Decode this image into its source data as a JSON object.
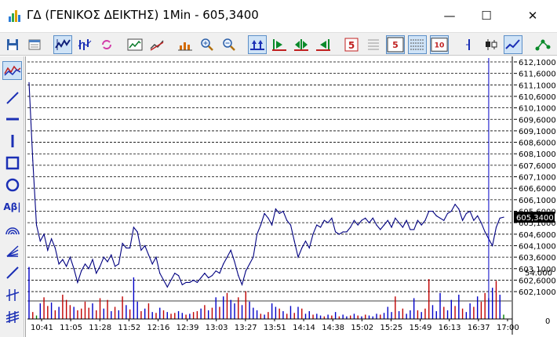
{
  "window": {
    "title": "ΓΔ (ΓΕΝΙΚΟΣ ΔΕΙΚΤΗΣ) 1Min - 605,3400",
    "minimize_glyph": "—",
    "maximize_glyph": "☐",
    "close_glyph": "✕"
  },
  "toolbar": {
    "period_labels": [
      "5",
      "5",
      "10"
    ]
  },
  "sidebar": {
    "text_tool_label": "Aβ|"
  },
  "colors": {
    "price_line": "#000080",
    "volume_up": "#0000c8",
    "volume_down": "#c00000",
    "volume_neutral": "#008000",
    "grid": "#000000",
    "current_price_bg": "#000000",
    "current_price_fg": "#ffffff",
    "cursor_line": "#0000c8"
  },
  "chart_data": {
    "type": "line",
    "price_axis": {
      "ylim": [
        601.83,
        612.27
      ],
      "tick_values": [
        612.1,
        611.6,
        611.1,
        610.6,
        610.1,
        609.6,
        609.1,
        608.6,
        608.1,
        607.6,
        607.1,
        606.6,
        606.1,
        605.6,
        605.1,
        604.6,
        604.1,
        603.6,
        603.1,
        602.6,
        602.1
      ],
      "tick_labels": [
        "612,1000",
        "611,6000",
        "611,1000",
        "610,6000",
        "610,1000",
        "609,6000",
        "609,1000",
        "608,6000",
        "608,1000",
        "607,6000",
        "607,1000",
        "606,6000",
        "606,1000",
        "605,6000",
        "605,1000",
        "604,6000",
        "604,1000",
        "603,6000",
        "603,1000",
        "602,6000",
        "602,1000"
      ],
      "current_value": 605.34,
      "current_label": "605,3400",
      "grid": true
    },
    "volume_axis": {
      "tick_labels": [
        "54.000",
        "0"
      ],
      "tick_values": [
        54000,
        0
      ],
      "ylim": [
        0,
        66000
      ]
    },
    "x_tick_labels": [
      "10:41",
      "11:05",
      "11:28",
      "11:52",
      "12:16",
      "12:39",
      "13:03",
      "13:27",
      "13:51",
      "14:14",
      "14:38",
      "15:02",
      "15:25",
      "15:49",
      "16:13",
      "16:37",
      "17:00"
    ],
    "price_series": [
      [
        0,
        611.2
      ],
      [
        1,
        607.8
      ],
      [
        2,
        605.0
      ],
      [
        3,
        604.3
      ],
      [
        4,
        604.6
      ],
      [
        5,
        603.9
      ],
      [
        6,
        604.4
      ],
      [
        7,
        604.0
      ],
      [
        8,
        603.3
      ],
      [
        9,
        603.5
      ],
      [
        10,
        603.2
      ],
      [
        11,
        603.6
      ],
      [
        12,
        603.1
      ],
      [
        13,
        602.5
      ],
      [
        14,
        603.0
      ],
      [
        15,
        603.3
      ],
      [
        16,
        603.1
      ],
      [
        17,
        603.5
      ],
      [
        18,
        602.9
      ],
      [
        19,
        603.2
      ],
      [
        20,
        603.6
      ],
      [
        21,
        603.4
      ],
      [
        22,
        603.7
      ],
      [
        23,
        603.2
      ],
      [
        24,
        603.3
      ],
      [
        25,
        604.2
      ],
      [
        26,
        604.0
      ],
      [
        27,
        604.0
      ],
      [
        28,
        604.9
      ],
      [
        29,
        604.7
      ],
      [
        30,
        603.9
      ],
      [
        31,
        604.1
      ],
      [
        32,
        603.7
      ],
      [
        33,
        603.3
      ],
      [
        34,
        603.6
      ],
      [
        35,
        602.9
      ],
      [
        36,
        602.6
      ],
      [
        37,
        602.3
      ],
      [
        38,
        602.6
      ],
      [
        39,
        602.9
      ],
      [
        40,
        602.8
      ],
      [
        41,
        602.4
      ],
      [
        42,
        602.5
      ],
      [
        43,
        602.5
      ],
      [
        44,
        602.6
      ],
      [
        45,
        602.5
      ],
      [
        46,
        602.7
      ],
      [
        47,
        602.9
      ],
      [
        48,
        602.7
      ],
      [
        49,
        602.8
      ],
      [
        50,
        603.0
      ],
      [
        51,
        602.9
      ],
      [
        52,
        603.3
      ],
      [
        53,
        603.6
      ],
      [
        54,
        603.9
      ],
      [
        55,
        603.4
      ],
      [
        56,
        602.8
      ],
      [
        57,
        602.4
      ],
      [
        58,
        603.0
      ],
      [
        59,
        603.3
      ],
      [
        60,
        603.6
      ],
      [
        61,
        604.6
      ],
      [
        62,
        605.0
      ],
      [
        63,
        605.5
      ],
      [
        64,
        605.3
      ],
      [
        65,
        605.0
      ],
      [
        66,
        605.7
      ],
      [
        67,
        605.5
      ],
      [
        68,
        605.6
      ],
      [
        69,
        605.2
      ],
      [
        70,
        605.0
      ],
      [
        71,
        604.3
      ],
      [
        72,
        603.6
      ],
      [
        73,
        604.0
      ],
      [
        74,
        604.3
      ],
      [
        75,
        604.0
      ],
      [
        76,
        604.6
      ],
      [
        77,
        605.0
      ],
      [
        78,
        604.9
      ],
      [
        79,
        605.2
      ],
      [
        80,
        605.1
      ],
      [
        81,
        605.3
      ],
      [
        82,
        604.7
      ],
      [
        83,
        604.6
      ],
      [
        84,
        604.7
      ],
      [
        85,
        604.7
      ],
      [
        86,
        604.9
      ],
      [
        87,
        605.2
      ],
      [
        88,
        605.0
      ],
      [
        89,
        605.2
      ],
      [
        90,
        605.3
      ],
      [
        91,
        605.1
      ],
      [
        92,
        605.3
      ],
      [
        93,
        605.0
      ],
      [
        94,
        604.8
      ],
      [
        95,
        605.0
      ],
      [
        96,
        605.2
      ],
      [
        97,
        604.9
      ],
      [
        98,
        605.3
      ],
      [
        99,
        605.1
      ],
      [
        100,
        604.9
      ],
      [
        101,
        605.2
      ],
      [
        102,
        604.8
      ],
      [
        103,
        604.8
      ],
      [
        104,
        605.2
      ],
      [
        105,
        605.0
      ],
      [
        106,
        605.2
      ],
      [
        107,
        605.6
      ],
      [
        108,
        605.6
      ],
      [
        109,
        605.4
      ],
      [
        110,
        605.3
      ],
      [
        111,
        605.2
      ],
      [
        112,
        605.5
      ],
      [
        113,
        605.6
      ],
      [
        114,
        605.9
      ],
      [
        115,
        605.7
      ],
      [
        116,
        605.2
      ],
      [
        117,
        605.5
      ],
      [
        118,
        605.6
      ],
      [
        119,
        605.2
      ],
      [
        120,
        605.4
      ],
      [
        121,
        605.1
      ],
      [
        122,
        604.7
      ],
      [
        123,
        604.4
      ],
      [
        124,
        604.1
      ],
      [
        125,
        604.9
      ],
      [
        126,
        605.3
      ],
      [
        127,
        605.34
      ]
    ],
    "volume_series": [
      [
        0,
        60000,
        "up"
      ],
      [
        1,
        8000,
        "down"
      ],
      [
        2,
        4000,
        "neutral"
      ],
      [
        3,
        18000,
        "up"
      ],
      [
        4,
        25000,
        "down"
      ],
      [
        5,
        15000,
        "down"
      ],
      [
        6,
        19000,
        "up"
      ],
      [
        7,
        10000,
        "down"
      ],
      [
        8,
        14000,
        "up"
      ],
      [
        9,
        28000,
        "down"
      ],
      [
        10,
        22000,
        "down"
      ],
      [
        11,
        16000,
        "down"
      ],
      [
        12,
        14000,
        "up"
      ],
      [
        13,
        10000,
        "down"
      ],
      [
        14,
        12000,
        "down"
      ],
      [
        15,
        20000,
        "down"
      ],
      [
        16,
        13000,
        "down"
      ],
      [
        17,
        18000,
        "up"
      ],
      [
        18,
        10000,
        "down"
      ],
      [
        19,
        24000,
        "down"
      ],
      [
        20,
        12000,
        "up"
      ],
      [
        21,
        22000,
        "down"
      ],
      [
        22,
        9000,
        "up"
      ],
      [
        23,
        14000,
        "down"
      ],
      [
        24,
        10000,
        "up"
      ],
      [
        25,
        26000,
        "down"
      ],
      [
        26,
        16000,
        "up"
      ],
      [
        27,
        11000,
        "down"
      ],
      [
        28,
        48000,
        "up"
      ],
      [
        29,
        20000,
        "up"
      ],
      [
        30,
        9000,
        "down"
      ],
      [
        31,
        12000,
        "up"
      ],
      [
        32,
        18000,
        "down"
      ],
      [
        33,
        8000,
        "up"
      ],
      [
        34,
        7000,
        "down"
      ],
      [
        35,
        13000,
        "up"
      ],
      [
        36,
        10000,
        "down"
      ],
      [
        37,
        8000,
        "up"
      ],
      [
        38,
        6000,
        "down"
      ],
      [
        39,
        7000,
        "down"
      ],
      [
        40,
        9000,
        "up"
      ],
      [
        41,
        7000,
        "up"
      ],
      [
        42,
        5000,
        "down"
      ],
      [
        43,
        6000,
        "up"
      ],
      [
        44,
        8000,
        "down"
      ],
      [
        45,
        9000,
        "down"
      ],
      [
        46,
        12000,
        "up"
      ],
      [
        47,
        16000,
        "down"
      ],
      [
        48,
        10000,
        "up"
      ],
      [
        49,
        13000,
        "down"
      ],
      [
        50,
        25000,
        "up"
      ],
      [
        51,
        14000,
        "down"
      ],
      [
        52,
        26000,
        "up"
      ],
      [
        53,
        30000,
        "down"
      ],
      [
        54,
        22000,
        "up"
      ],
      [
        55,
        18000,
        "up"
      ],
      [
        56,
        25000,
        "down"
      ],
      [
        57,
        16000,
        "up"
      ],
      [
        58,
        32000,
        "down"
      ],
      [
        59,
        20000,
        "up"
      ],
      [
        60,
        13000,
        "up"
      ],
      [
        61,
        10000,
        "up"
      ],
      [
        62,
        6000,
        "down"
      ],
      [
        63,
        5000,
        "up"
      ],
      [
        64,
        8000,
        "down"
      ],
      [
        65,
        18000,
        "up"
      ],
      [
        66,
        14000,
        "up"
      ],
      [
        67,
        12000,
        "down"
      ],
      [
        68,
        9000,
        "up"
      ],
      [
        69,
        6000,
        "down"
      ],
      [
        70,
        15000,
        "up"
      ],
      [
        71,
        7000,
        "down"
      ],
      [
        72,
        14000,
        "up"
      ],
      [
        73,
        12000,
        "down"
      ],
      [
        74,
        6000,
        "up"
      ],
      [
        75,
        9000,
        "up"
      ],
      [
        76,
        5000,
        "down"
      ],
      [
        77,
        6000,
        "up"
      ],
      [
        78,
        4000,
        "up"
      ],
      [
        79,
        3000,
        "down"
      ],
      [
        80,
        5000,
        "up"
      ],
      [
        81,
        4000,
        "down"
      ],
      [
        82,
        8000,
        "up"
      ],
      [
        83,
        3000,
        "down"
      ],
      [
        84,
        5000,
        "up"
      ],
      [
        85,
        3000,
        "up"
      ],
      [
        86,
        4000,
        "down"
      ],
      [
        87,
        6000,
        "up"
      ],
      [
        88,
        4000,
        "down"
      ],
      [
        89,
        3000,
        "up"
      ],
      [
        90,
        5000,
        "down"
      ],
      [
        91,
        4000,
        "up"
      ],
      [
        92,
        3000,
        "up"
      ],
      [
        93,
        6000,
        "up"
      ],
      [
        94,
        5000,
        "down"
      ],
      [
        95,
        7000,
        "up"
      ],
      [
        96,
        14000,
        "up"
      ],
      [
        97,
        8000,
        "up"
      ],
      [
        98,
        26000,
        "down"
      ],
      [
        99,
        9000,
        "up"
      ],
      [
        100,
        12000,
        "down"
      ],
      [
        101,
        6000,
        "up"
      ],
      [
        102,
        10000,
        "up"
      ],
      [
        103,
        24000,
        "up"
      ],
      [
        104,
        10000,
        "down"
      ],
      [
        105,
        8000,
        "up"
      ],
      [
        106,
        12000,
        "down"
      ],
      [
        107,
        46000,
        "down"
      ],
      [
        108,
        16000,
        "up"
      ],
      [
        109,
        9000,
        "up"
      ],
      [
        110,
        30000,
        "up"
      ],
      [
        111,
        14000,
        "down"
      ],
      [
        112,
        10000,
        "up"
      ],
      [
        113,
        22000,
        "up"
      ],
      [
        114,
        15000,
        "down"
      ],
      [
        115,
        28000,
        "up"
      ],
      [
        116,
        12000,
        "down"
      ],
      [
        117,
        8000,
        "up"
      ],
      [
        118,
        18000,
        "up"
      ],
      [
        119,
        14000,
        "down"
      ],
      [
        120,
        26000,
        "up"
      ],
      [
        121,
        20000,
        "down"
      ],
      [
        122,
        30000,
        "down"
      ],
      [
        123,
        24000,
        "up"
      ],
      [
        124,
        36000,
        "up"
      ],
      [
        125,
        44000,
        "down"
      ],
      [
        126,
        28000,
        "up"
      ],
      [
        127,
        5000,
        "neutral"
      ]
    ]
  }
}
